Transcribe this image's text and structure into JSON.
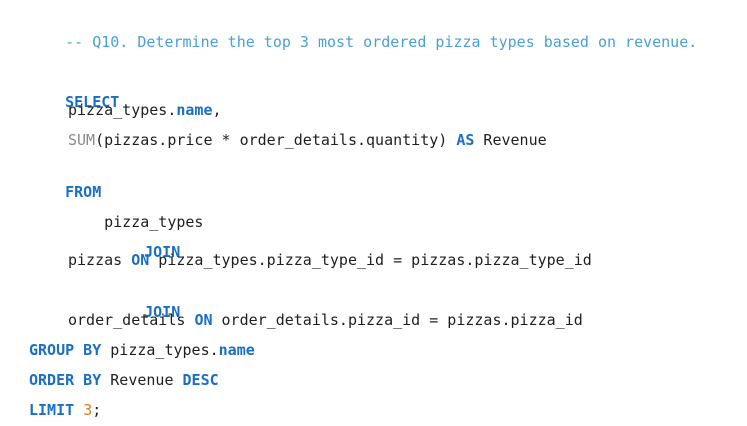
{
  "comment": "-- Q10. Determine the top 3 most ordered pizza types based on revenue.",
  "code": {
    "select_kw": "SELECT",
    "col1_prefix": "pizza_types.",
    "col1_name_kw": "name",
    "col1_suffix": ",",
    "sum_fn": "SUM",
    "sum_args": "(pizzas.price * order_details.quantity) ",
    "as_kw": "AS",
    "alias": " Revenue",
    "from_kw": "FROM",
    "table1": "pizza_types",
    "join1_kw": "JOIN",
    "table2": "pizzas ",
    "on1_kw": "ON",
    "on1_cond": " pizza_types.pizza_type_id = pizzas.pizza_type_id",
    "join2_kw": "JOIN",
    "table3": "order_details ",
    "on2_kw": "ON",
    "on2_cond": " order_details.pizza_id = pizzas.pizza_id",
    "group_by_kw": "GROUP BY",
    "group_by_prefix": " pizza_types.",
    "group_by_name_kw": "name",
    "order_by_kw": "ORDER BY",
    "order_by_col": " Revenue ",
    "desc_kw": "DESC",
    "limit_kw": "LIMIT",
    "limit_space": " ",
    "limit_num": "3",
    "limit_end": ";"
  },
  "colors": {
    "comment": "#4a9fd6",
    "keyword": "#1a6fc4",
    "function": "#8a8a8a",
    "number": "#e07a1f",
    "text": "#1f1f1f"
  }
}
